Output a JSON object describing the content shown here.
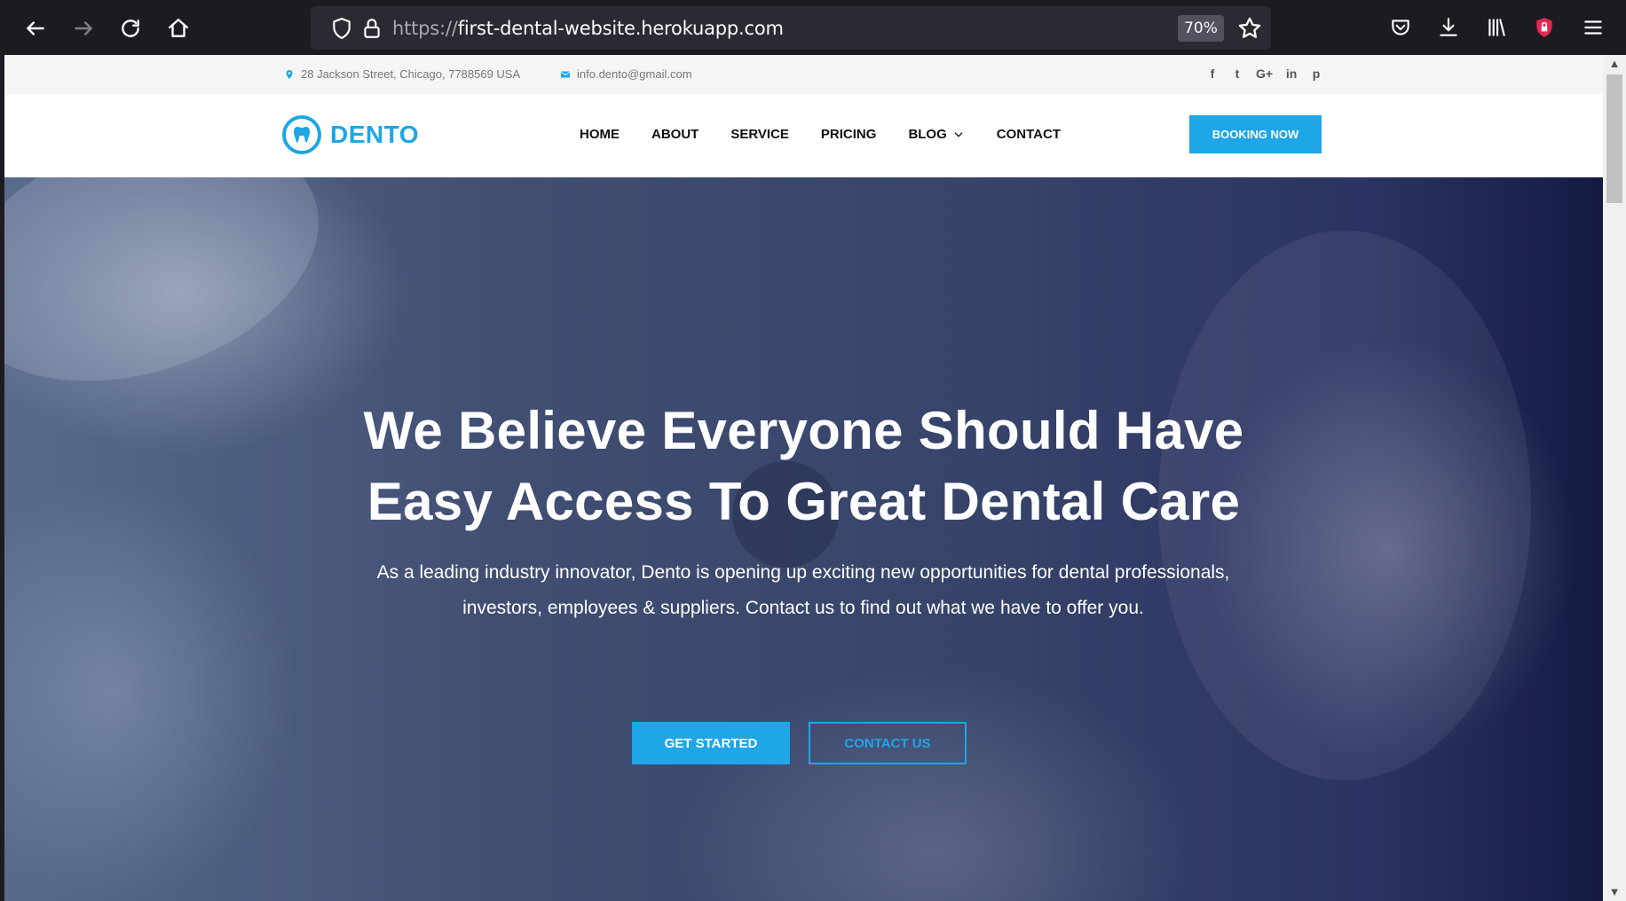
{
  "browser": {
    "url_scheme": "https://",
    "url_host": "first-dental-website.herokuapp.com",
    "zoom": "70%"
  },
  "topbar": {
    "address": "28 Jackson Street, Chicago, 7788569 USA",
    "email": "info.dento@gmail.com",
    "socials": [
      "f",
      "t",
      "G+",
      "in",
      "p"
    ]
  },
  "header": {
    "logo_text": "DENTO",
    "menu": [
      "HOME",
      "ABOUT",
      "SERVICE",
      "PRICING",
      "BLOG",
      "CONTACT"
    ],
    "booking_label": "BOOKING NOW"
  },
  "hero": {
    "title_line1": "We Believe Everyone Should Have",
    "title_line2": "Easy Access To Great Dental Care",
    "subtitle_line1": "As a leading industry innovator, Dento is opening up exciting new opportunities for dental professionals,",
    "subtitle_line2": "investors, employees & suppliers. Contact us to find out what we have to offer you.",
    "primary_button": "GET STARTED",
    "secondary_button": "CONTACT US"
  },
  "colors": {
    "accent": "#1ea6e7",
    "chrome_bg": "#1c1b22",
    "urlbar_bg": "#2b2a33"
  }
}
